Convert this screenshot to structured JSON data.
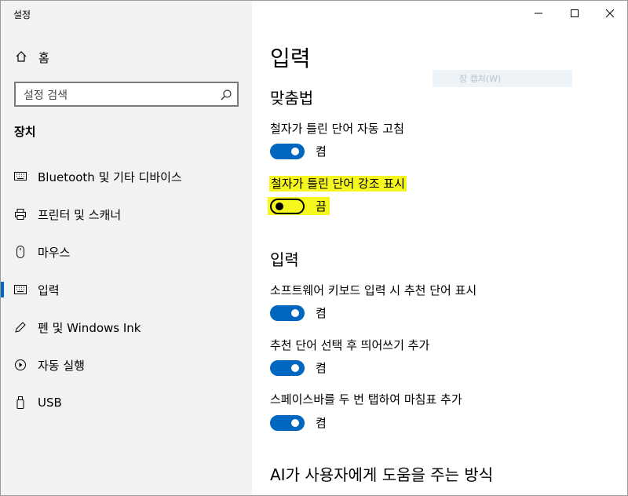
{
  "window": {
    "title": "설정"
  },
  "sidebar": {
    "home_label": "홈",
    "search_placeholder": "설정 검색",
    "section_title": "장치",
    "items": [
      {
        "label": "Bluetooth 및 기타 디바이스",
        "icon": "bluetooth-devices-icon"
      },
      {
        "label": "프린터 및 스캐너",
        "icon": "printer-icon"
      },
      {
        "label": "마우스",
        "icon": "mouse-icon"
      },
      {
        "label": "입력",
        "icon": "keyboard-icon",
        "active": true
      },
      {
        "label": "펜 및 Windows Ink",
        "icon": "pen-icon"
      },
      {
        "label": "자동 실행",
        "icon": "autoplay-icon"
      },
      {
        "label": "USB",
        "icon": "usb-icon"
      }
    ]
  },
  "main": {
    "page_title": "입력",
    "watermark": "장 캡처(W)",
    "spellcheck": {
      "heading": "맞춤법",
      "autocorrect": {
        "label": "철자가 틀린 단어 자동 고침",
        "state": "켬",
        "on": true
      },
      "highlight": {
        "label": "철자가 틀린 단어 강조 표시",
        "state": "끔",
        "on": false
      }
    },
    "typing": {
      "heading": "입력",
      "suggestions": {
        "label": "소프트웨어 키보드 입력 시 추천 단어 표시",
        "state": "켬",
        "on": true
      },
      "space_after": {
        "label": "추천 단어 선택 후 띄어쓰기 추가",
        "state": "켬",
        "on": true
      },
      "period": {
        "label": "스페이스바를 두 번 탭하여 마침표 추가",
        "state": "켬",
        "on": true
      }
    },
    "ai_heading": "AI가 사용자에게 도움을 주는 방식"
  },
  "colors": {
    "accent": "#0067c0",
    "highlight": "#f7f720",
    "sidebar_bg": "#f2f2f2"
  }
}
